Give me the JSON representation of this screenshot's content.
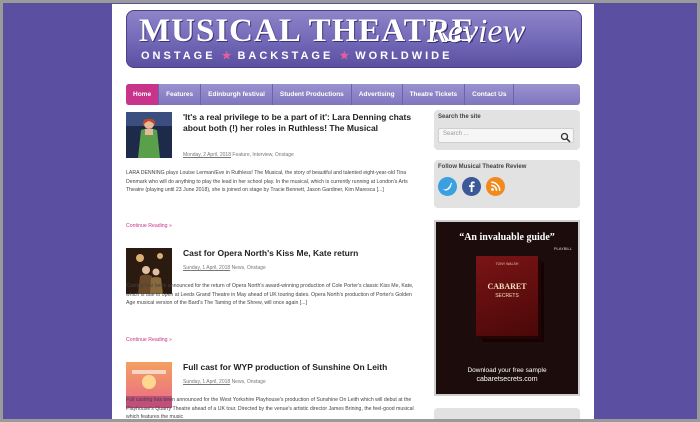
{
  "header": {
    "title": "MUSICAL THEATRE",
    "title_script": "Review",
    "tagline_parts": [
      "ONSTAGE",
      "BACKSTAGE",
      "WORLDWIDE"
    ]
  },
  "nav": {
    "items": [
      "Home",
      "Features",
      "Edinburgh festival",
      "Student Productions",
      "Advertising",
      "Theatre Tickets",
      "Contact Us"
    ],
    "active": "Home"
  },
  "posts": [
    {
      "title": "'It's a real privilege to be a part of it': Lara Denning chats about both (!) her roles in Ruthless! The Musical",
      "date": "Monday, 2 April, 2018",
      "categories": "Feature, Interview, Onstage",
      "excerpt": "LARA DENNING plays Louise Lerman/Eve in Ruthless! The Musical, the story of beautiful and talented eight-year-old Tina Denmark who will do anything to play the lead in her school play. In the musical, which is currently running at London's Arts Theatre (playing until 23 June 2018), she is joined on stage by Tracie Bennett, Jason Gardiner, Kim Maresca [...]",
      "continue": "Continue Reading »"
    },
    {
      "title": "Cast for Opera North's Kiss Me, Kate return",
      "date": "Sunday, 1 April, 2018",
      "categories": "News, Onstage",
      "excerpt": "Casting has been announced for the return of Opera North's award-winning production of Cole Porter's classic Kiss Me, Kate, which is due to open at Leeds Grand Theatre in May ahead of UK touring dates. Opera North's production of Porter's Golden Age musical version of the Bard's The Taming of the Shrew, will once again [...]",
      "continue": "Continue Reading »"
    },
    {
      "title": "Full cast for WYP production of Sunshine On Leith",
      "date": "Sunday, 1 April, 2018",
      "categories": "News, Onstage",
      "excerpt": "Full casting has been announced for the West Yorkshire Playhouse's production of Sunshine On Leith which will debut at the Playhouse's Quarry Theatre ahead of a UK tour. Directed by the venue's artistic director James Brining, the feel-good musical which features the music"
    }
  ],
  "sidebar": {
    "search": {
      "title": "Search the site",
      "placeholder": "Search ..."
    },
    "follow": {
      "title": "Follow Musical Theatre Review",
      "icons": [
        "twitter-icon",
        "facebook-icon",
        "rss-icon"
      ]
    },
    "ad": {
      "quote": "“An invaluable guide”",
      "quote_source": "PLAYBILL",
      "book_author": "TONY WALSH",
      "book_title": "CABARET",
      "book_subtitle": "SECRETS",
      "footer_line1": "Download your free sample",
      "footer_line2": "cabaretsecrets.com"
    }
  },
  "colors": {
    "background": "#5a4fa0",
    "accent": "#c8348a",
    "nav": "#8076bf"
  }
}
